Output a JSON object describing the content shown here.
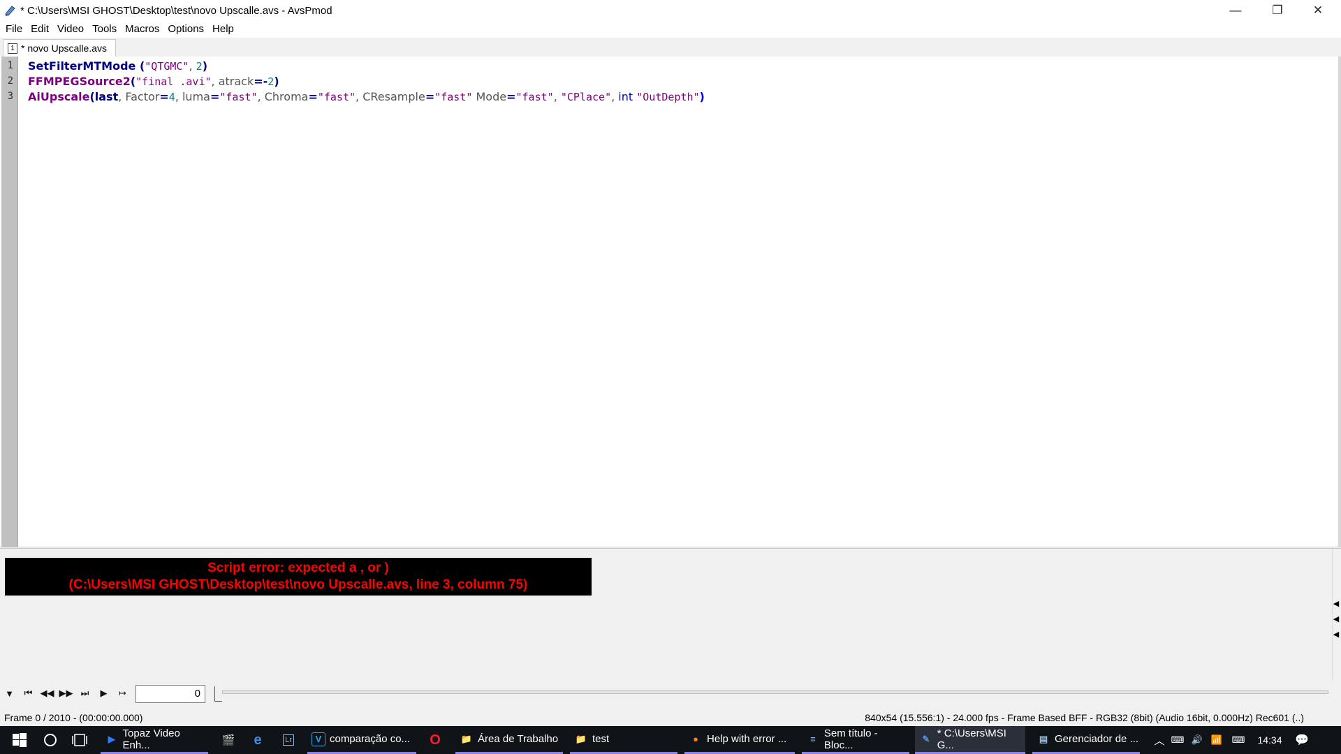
{
  "window": {
    "title": "* C:\\Users\\MSI GHOST\\Desktop\\test\\novo Upscalle.avs - AvsPmod",
    "minimize": "—",
    "maximize": "❐",
    "close": "✕"
  },
  "menu": [
    "File",
    "Edit",
    "Video",
    "Tools",
    "Macros",
    "Options",
    "Help"
  ],
  "tab": {
    "label": "* novo Upscalle.avs",
    "icon_text": "1"
  },
  "editor": {
    "line_numbers": [
      "1",
      "2",
      "3"
    ],
    "line1": {
      "fn": "SetFilterMTMode",
      "open": " (",
      "s1": "\"QTGMC\"",
      "sep": ", ",
      "n1": "2",
      "close": ")"
    },
    "line2": {
      "fn": "FFMPEGSource2",
      "open": "(",
      "s1": "\"final .avi\"",
      "sep": ", ",
      "arg": "atrack",
      "eq": "=-",
      "n1": "2",
      "close": ")"
    },
    "line3": {
      "fn": "AiUpscale",
      "open": "(",
      "last": "last",
      "sep1": ", ",
      "factor": "Factor",
      "eq1": "=",
      "n_factor": "4",
      "sep2": ", ",
      "luma": "luma",
      "eq2": "=",
      "s_luma": "\"fast\"",
      "sep3": ", ",
      "chroma": "Chroma",
      "eq3": "=",
      "s_chroma": "\"fast\"",
      "sep4": ", ",
      "cresample": "CResample",
      "eq4": "=",
      "s_cresample": "\"fast\"",
      "sp5": " ",
      "mode": "Mode",
      "eq5": "=",
      "s_mode": "\"fast\"",
      "sep6": ", ",
      "s_cplace": "\"CPlace\"",
      "sep7": ", ",
      "kw_int": "int",
      "sp8": " ",
      "s_outdepth": "\"OutDepth\"",
      "close": ")"
    }
  },
  "preview": {
    "error_line1": "Script error: expected a , or )",
    "error_line2": "(C:\\Users\\MSI GHOST\\Desktop\\test\\novo Upscalle.avs, line 3, column 75)"
  },
  "playback": {
    "frame_value": "0",
    "buttons": [
      "▼",
      "⏮",
      "◀◀",
      "▶▶",
      "⏭",
      "▶",
      "↦"
    ]
  },
  "status": {
    "left": "Frame 0 / 2010  -  (00:00:00.000)",
    "right": "840x54 (15.556:1) - 24.000 fps - Frame Based BFF - RGB32 (8bit) (Audio 16bit, 0.000Hz) Rec601 (..)"
  },
  "taskbar": {
    "apps": [
      {
        "label": "Topaz Video Enh...",
        "icon": "▶",
        "color": "#2d7cff"
      },
      {
        "label": "comparação co...",
        "icon": "V",
        "color": "#2aa3e8"
      },
      {
        "label": "Área de Trabalho",
        "icon": "📁",
        "color": "#f2c14e"
      },
      {
        "label": "test",
        "icon": "📁",
        "color": "#f2c14e"
      },
      {
        "label": "Help with error ...",
        "icon": "●",
        "color": "#ff7b22"
      },
      {
        "label": "Sem título - Bloc...",
        "icon": "≡",
        "color": "#9bc4e8"
      },
      {
        "label": "* C:\\Users\\MSI G...",
        "icon": "✎",
        "color": "#4a90e2"
      },
      {
        "label": "Gerenciador de ...",
        "icon": "▤",
        "color": "#9bb7d4"
      }
    ],
    "time": "14:34"
  },
  "colors": {
    "error_text": "#ff0000",
    "taskbar_bg": "#101318",
    "taskbar_underline": "#8a7cff"
  }
}
